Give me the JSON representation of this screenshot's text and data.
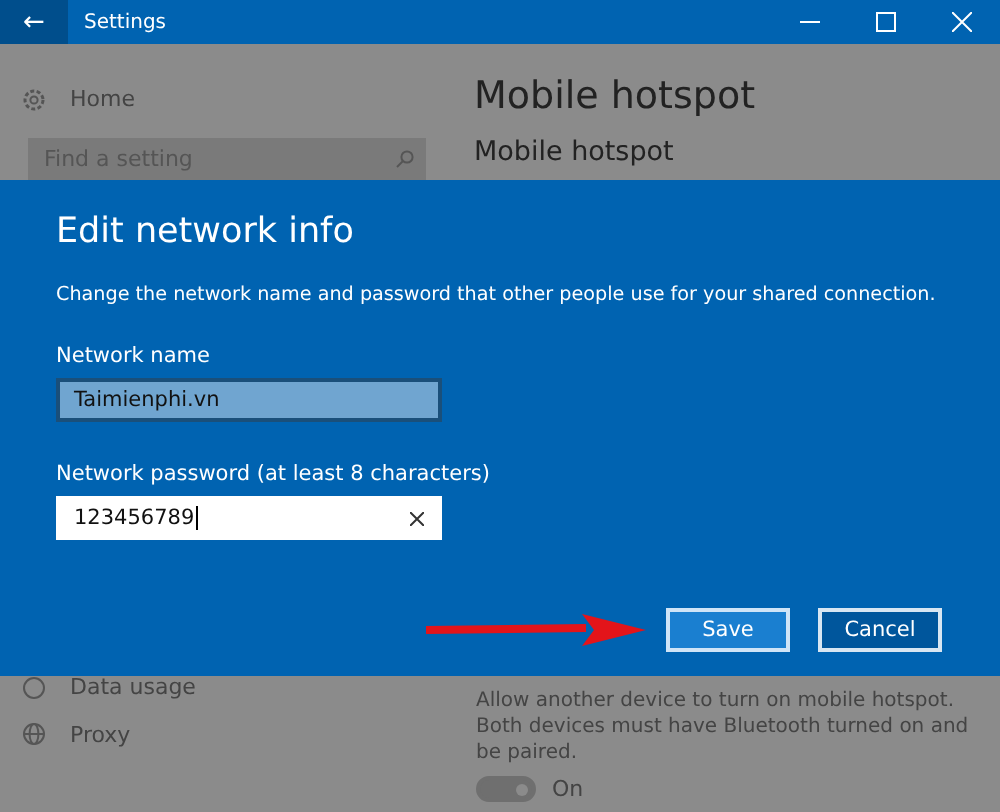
{
  "window": {
    "title": "Settings",
    "back": "←"
  },
  "sidebar": {
    "home": "Home",
    "search_placeholder": "Find a setting",
    "items_below": [
      {
        "label": "Data usage",
        "kind": "data"
      },
      {
        "label": "Proxy",
        "kind": "globe"
      }
    ]
  },
  "content": {
    "heading": "Mobile hotspot",
    "subheading": "Mobile hotspot",
    "remote_text": "Allow another device to turn on mobile hotspot. Both devices must have Bluetooth turned on and be paired.",
    "remote_toggle": {
      "on": true,
      "label": "On"
    }
  },
  "dialog": {
    "title": "Edit network info",
    "description": "Change the network name and password that other people use for your shared connection.",
    "fields": [
      {
        "label": "Network name",
        "value": "Taimienphi.vn",
        "focused": false
      },
      {
        "label": "Network password (at least 8 characters)",
        "value": "123456789",
        "focused": true
      }
    ],
    "buttons": [
      {
        "label": "Save",
        "selected": true
      },
      {
        "label": "Cancel",
        "selected": false
      }
    ]
  }
}
